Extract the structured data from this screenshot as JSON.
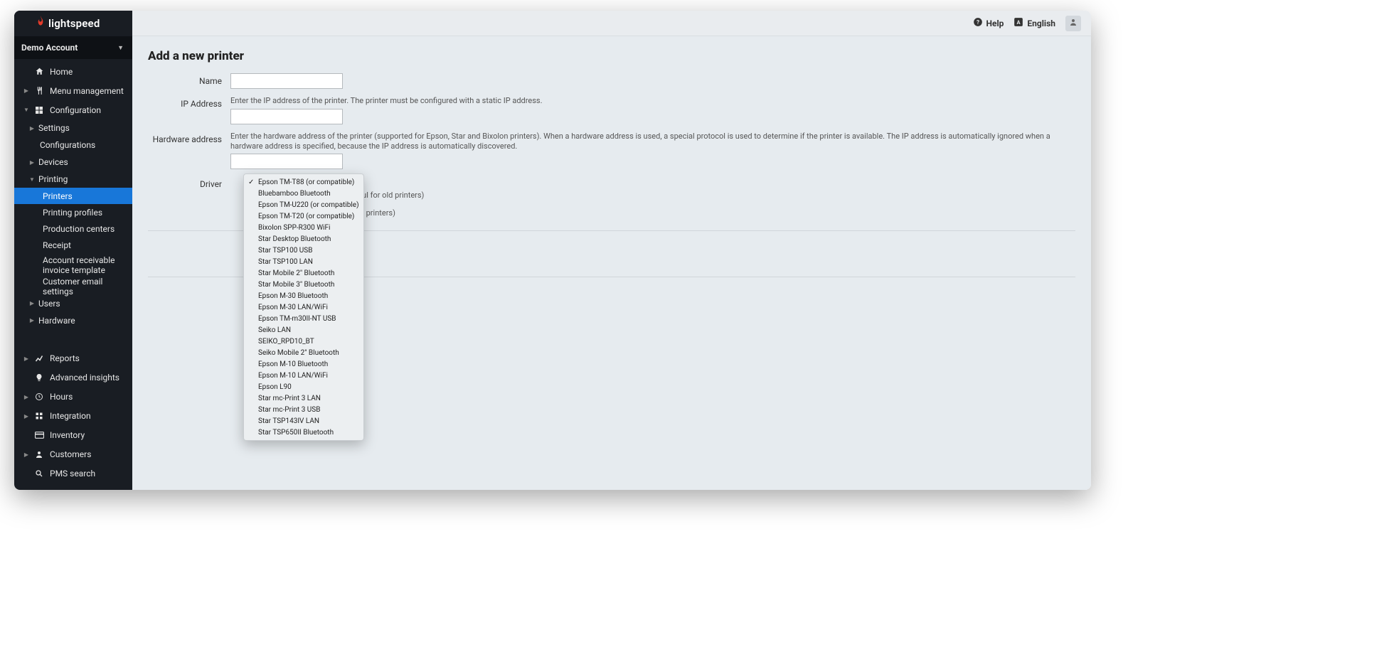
{
  "brand": {
    "name": "lightspeed"
  },
  "account": {
    "label": "Demo Account"
  },
  "topbar": {
    "help_label": "Help",
    "language_label": "English"
  },
  "sidebar": {
    "home": "Home",
    "menu_management": "Menu management",
    "configuration": "Configuration",
    "settings": "Settings",
    "configurations": "Configurations",
    "devices": "Devices",
    "printing": "Printing",
    "printers": "Printers",
    "printing_profiles": "Printing profiles",
    "production_centers": "Production centers",
    "receipt": "Receipt",
    "account_receivable": "Account receivable invoice template",
    "customer_email_settings": "Customer email settings",
    "users": "Users",
    "hardware": "Hardware",
    "reports": "Reports",
    "advanced_insights": "Advanced insights",
    "hours": "Hours",
    "integration": "Integration",
    "inventory": "Inventory",
    "customers": "Customers",
    "pms_search": "PMS search"
  },
  "page": {
    "title": "Add a new printer",
    "labels": {
      "name": "Name",
      "ip_address": "IP Address",
      "hardware_address": "Hardware address",
      "driver": "Driver"
    },
    "hints": {
      "ip": "Enter the IP address of the printer. The printer must be configured with a static IP address.",
      "hardware": "Enter the hardware address of the printer (supported for Epson, Star and Bixolon printers). When a hardware address is used, a special protocol is used to determine if the printer is available. The IP address is automatically ignored when a hardware address is specified, because the IP address is automatically discovered."
    },
    "behind_text_1": "(useful for old printers)",
    "behind_text_2": "or old printers)",
    "driver_options": [
      "Epson TM-T88 (or compatible)",
      "Bluebamboo Bluetooth",
      "Epson TM-U220 (or compatible)",
      "Epson TM-T20 (or compatible)",
      "Bixolon SPP-R300 WiFi",
      "Star Desktop Bluetooth",
      "Star TSP100 USB",
      "Star TSP100 LAN",
      "Star Mobile 2\" Bluetooth",
      "Star Mobile 3\" Bluetooth",
      "Epson M-30 Bluetooth",
      "Epson M-30 LAN/WiFi",
      "Epson TM-m30II-NT USB",
      "Seiko LAN",
      "SEIKO_RPD10_BT",
      "Seiko Mobile 2\" Bluetooth",
      "Epson M-10 Bluetooth",
      "Epson M-10 LAN/WiFi",
      "Epson L90",
      "Star mc-Print 3 LAN",
      "Star mc-Print 3 USB",
      "Star TSP143IV LAN",
      "Star TSP650II Bluetooth"
    ],
    "driver_selected_index": 0
  }
}
